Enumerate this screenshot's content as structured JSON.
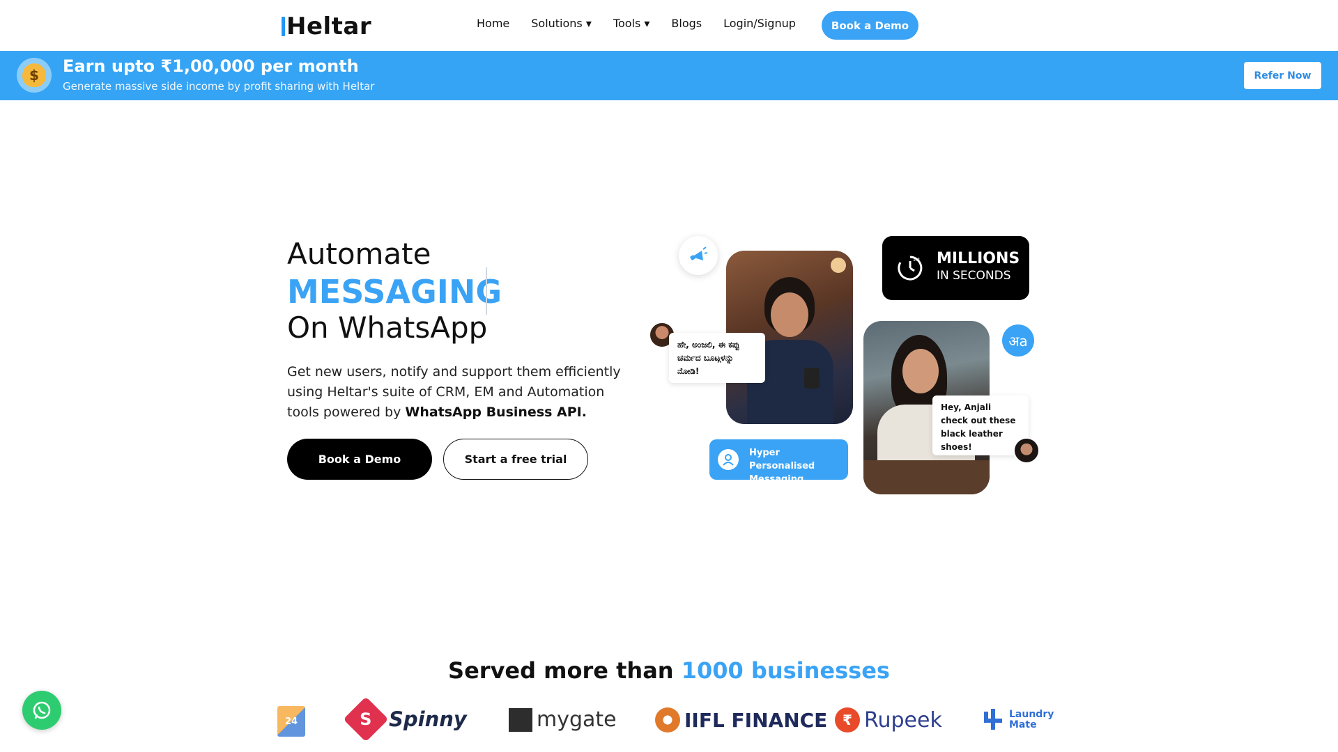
{
  "nav": {
    "logo": "Heltar",
    "items": [
      "Home",
      "Solutions ▾",
      "Tools ▾",
      "Blogs",
      "Login/Signup"
    ],
    "cta": "Book a Demo"
  },
  "banner": {
    "icon": "money-bag-icon",
    "title": "Earn upto ₹1,00,000 per month",
    "subtitle": "Generate massive side income by profit sharing with Heltar",
    "button": "Refer Now"
  },
  "hero": {
    "line1": "Automate",
    "line2": "MESSAGING",
    "line3": "On WhatsApp",
    "desc_plain": "Get new users, notify and support them efficiently using Heltar's suite of CRM, EM and Automation tools powered by ",
    "desc_bold": "WhatsApp Business API.",
    "btn_primary": "Book a Demo",
    "btn_secondary": "Start a free trial"
  },
  "visual": {
    "millions_big": "MILLIONS",
    "millions_small": "IN SECONDS",
    "bubble1": "ಹೇ, ಅಂಜಲಿ, ಈ ಕಪ್ಪು ಚರ್ಮದ ಬೂಟ್ಗಳನ್ನು ನೋಡಿ!",
    "bubble2": "Hey, Anjali check out these black leather shoes!",
    "lang_badge": "अa",
    "hyper_line1": "Hyper Personalised",
    "hyper_line2": "Messaging"
  },
  "served": {
    "prefix": "Served more than ",
    "highlight": "1000 businesses"
  },
  "clients": {
    "c24": "24",
    "spinny": "Spinny",
    "mygate": "mygate",
    "iifl": "IIFL FINANCE",
    "rupeek": "Rupeek",
    "laundry1": "Laundry",
    "laundry2": "Mate"
  },
  "colors": {
    "accent": "#3aa3f5",
    "banner": "#36a4f4",
    "dark": "#000000",
    "whatsapp": "#2ecc71"
  }
}
